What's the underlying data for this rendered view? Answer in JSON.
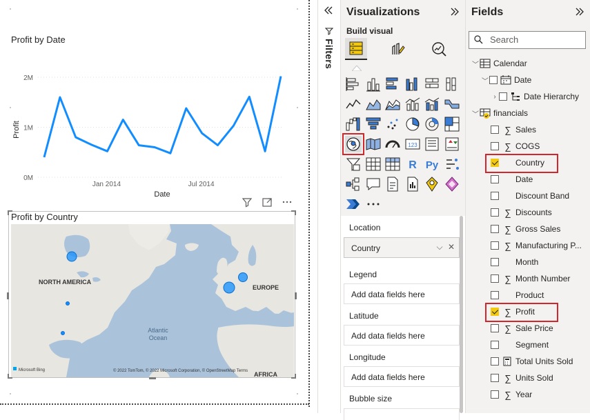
{
  "report_canvas": {
    "line_chart": {
      "title": "Profit by Date",
      "chart_data": {
        "type": "line",
        "title": "Profit by Date",
        "xlabel": "Date",
        "ylabel": "Profit",
        "x_ticks": [
          "Jan 2014",
          "Jul 2014"
        ],
        "y_ticks": [
          "0M",
          "1M",
          "2M"
        ],
        "ylim": [
          0,
          2000000
        ],
        "grid": true,
        "series": [
          {
            "color": "#118dff",
            "x": [
              "2013-09",
              "2013-10",
              "2013-11",
              "2013-12",
              "2014-01",
              "2014-02",
              "2014-03",
              "2014-04",
              "2014-05",
              "2014-06",
              "2014-07",
              "2014-08",
              "2014-09",
              "2014-10",
              "2014-11",
              "2014-12"
            ],
            "values": [
              400000,
              1600000,
              800000,
              650000,
              520000,
              1150000,
              640000,
              600000,
              480000,
              1380000,
              880000,
              640000,
              1030000,
              1610000,
              520000,
              2020000
            ]
          }
        ]
      }
    },
    "map_visual": {
      "title": "Profit by Country",
      "labels": {
        "north_america": "NORTH AMERICA",
        "europe": "EUROPE",
        "atlantic_ocean": "Atlantic\nOcean",
        "africa": "AFRICA"
      },
      "attribution": "© 2022 TomTom, © 2022 Microsoft Corporation, © OpenStreetMap Terms",
      "provider": "Microsoft Bing",
      "bubble_color": "#118dff",
      "bubble_values": {
        "canada": "large",
        "usa": "small",
        "mexico": "small",
        "france": "large",
        "germany": "large"
      }
    },
    "header_icons": [
      "filter-icon",
      "focus-mode-icon",
      "more-options-icon"
    ]
  },
  "filters_pane": {
    "label": "Filters",
    "collapse_icon": "double-chevron-left-icon"
  },
  "visualizations_pane": {
    "title": "Visualizations",
    "build_visual_label": "Build visual",
    "tabs": [
      "build-visual-tab",
      "format-visual-tab",
      "analytics-tab"
    ],
    "selected_visual": "map-visual",
    "wells": [
      {
        "label": "Location",
        "value": "Country",
        "filled": true
      },
      {
        "label": "Legend",
        "value": "Add data fields here",
        "filled": false
      },
      {
        "label": "Latitude",
        "value": "Add data fields here",
        "filled": false
      },
      {
        "label": "Longitude",
        "value": "Add data fields here",
        "filled": false
      },
      {
        "label": "Bubble size",
        "value": "",
        "filled": false
      }
    ]
  },
  "fields_pane": {
    "title": "Fields",
    "search_placeholder": "Search",
    "tables": [
      {
        "name": "Calendar",
        "fields": [
          {
            "name": "Date",
            "type": "calendar"
          },
          {
            "name": "Date Hierarchy",
            "type": "hierarchy"
          }
        ]
      },
      {
        "name": "financials",
        "fields": [
          {
            "name": "Sales",
            "sigma": true,
            "checked": false
          },
          {
            "name": "COGS",
            "sigma": true,
            "checked": false
          },
          {
            "name": "Country",
            "sigma": false,
            "checked": true
          },
          {
            "name": "Date",
            "sigma": false,
            "checked": false
          },
          {
            "name": "Discount Band",
            "sigma": false,
            "checked": false
          },
          {
            "name": "Discounts",
            "sigma": true,
            "checked": false
          },
          {
            "name": "Gross Sales",
            "sigma": true,
            "checked": false
          },
          {
            "name": "Manufacturing P...",
            "sigma": true,
            "checked": false
          },
          {
            "name": "Month",
            "sigma": false,
            "checked": false
          },
          {
            "name": "Month Number",
            "sigma": true,
            "checked": false
          },
          {
            "name": "Product",
            "sigma": false,
            "checked": false
          },
          {
            "name": "Profit",
            "sigma": true,
            "checked": true
          },
          {
            "name": "Sale Price",
            "sigma": true,
            "checked": false
          },
          {
            "name": "Segment",
            "sigma": false,
            "checked": false
          },
          {
            "name": "Total Units Sold",
            "sigma": false,
            "checked": false,
            "calculator": true
          },
          {
            "name": "Units Sold",
            "sigma": true,
            "checked": false
          },
          {
            "name": "Year",
            "sigma": true,
            "checked": false
          }
        ]
      }
    ]
  }
}
